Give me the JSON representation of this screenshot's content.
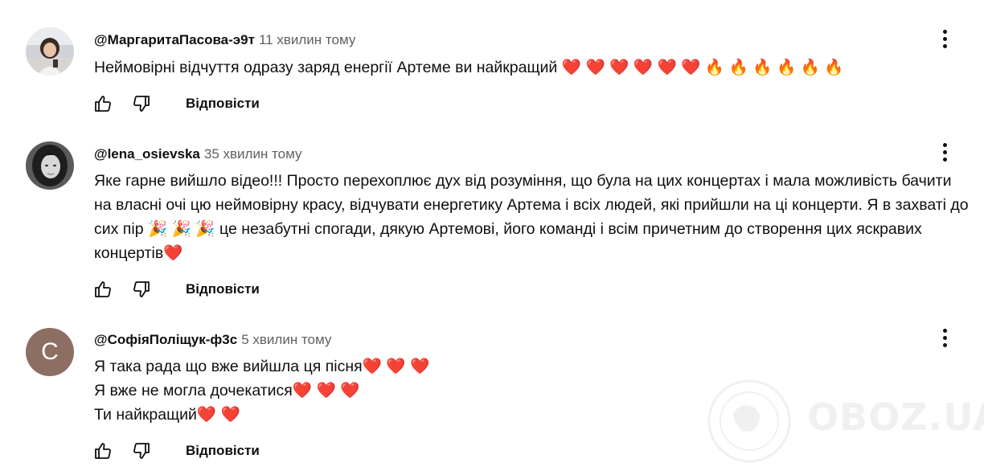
{
  "reply_label": "Відповісти",
  "watermark": "OBOZ.UA",
  "comments": [
    {
      "author": "@МаргаритаПасова-э9т",
      "time": "11 хвилин тому",
      "lines": [
        "Неймовірні відчуття одразу заряд енергії Артеме ви найкращий ❤️ ❤️ ❤️ ❤️ ❤️ ❤️ 🔥 🔥 🔥 🔥 🔥 🔥"
      ]
    },
    {
      "author": "@lena_osievska",
      "time": "35 хвилин тому",
      "lines": [
        "Яке гарне вийшло відео!!! Просто перехоплює дух від розуміння, що була на цих концертах і мала можливість бачити на власні очі цю неймовірну красу, відчувати енергетику Артема і всіх людей, які прийшли на ці концерти. Я в захваті до сих пір 🎉 🎉 🎉 це незабутні спогади, дякую Артемові, його команді і всім причетним до створення цих яскравих концертів❤️"
      ]
    },
    {
      "author": "@СофіяПоліщук-ф3с",
      "time": "5 хвилин тому",
      "avatar_letter": "С",
      "lines": [
        "Я така рада що вже вийшла ця пісня❤️ ❤️ ❤️",
        "Я вже не могла дочекатися❤️ ❤️ ❤️",
        "Ти найкращий❤️ ❤️"
      ]
    }
  ]
}
